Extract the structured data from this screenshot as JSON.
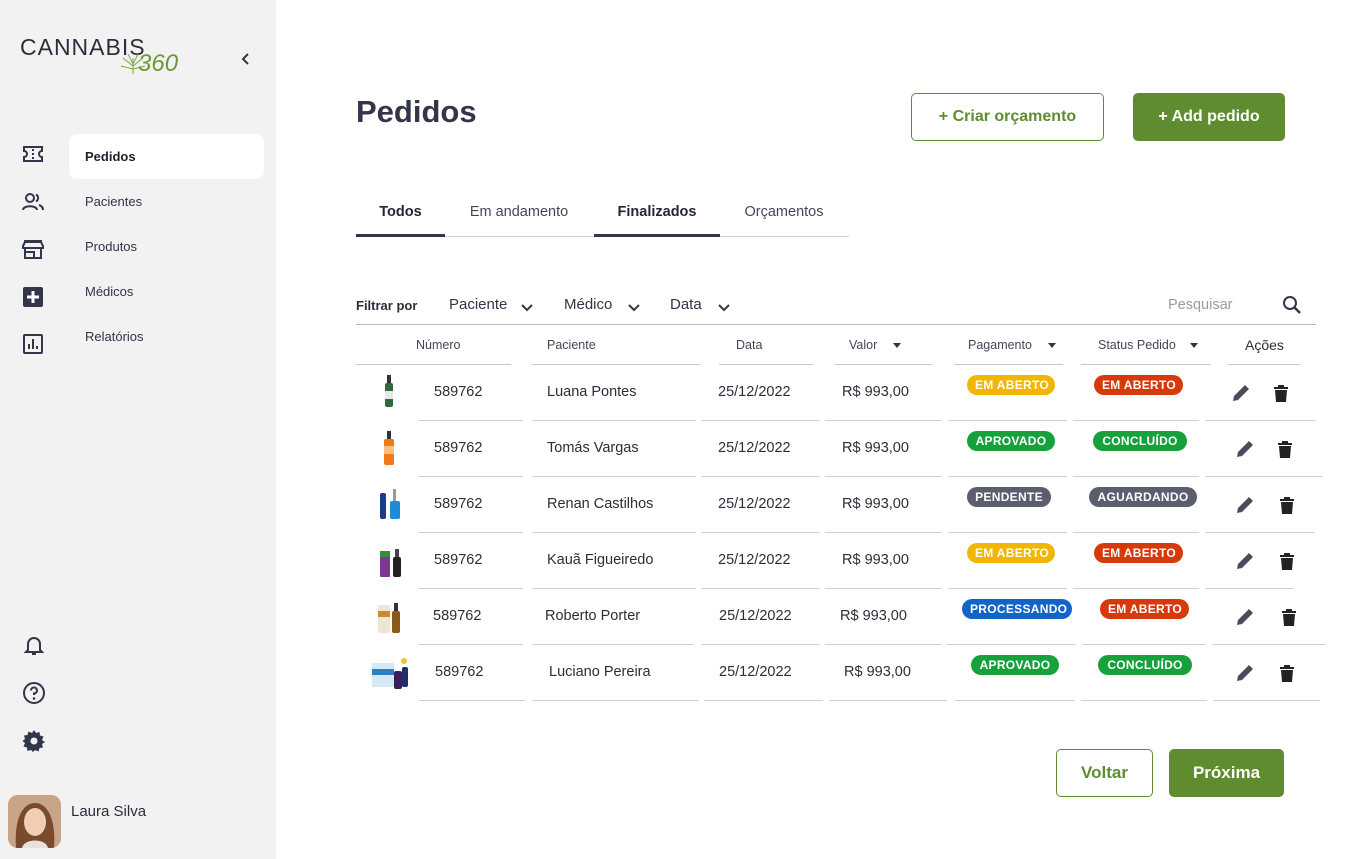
{
  "brand": {
    "word1": "CANNABIS",
    "word2": "360",
    "accent": "#5e8c2e"
  },
  "sidebar": {
    "items": [
      {
        "label": "Pedidos",
        "icon": "ticket-icon",
        "active": true
      },
      {
        "label": "Pacientes",
        "icon": "users-icon",
        "active": false
      },
      {
        "label": "Produtos",
        "icon": "store-icon",
        "active": false
      },
      {
        "label": "Médicos",
        "icon": "medical-plus-icon",
        "active": false
      },
      {
        "label": "Relatórios",
        "icon": "report-chart-icon",
        "active": false
      }
    ],
    "bottom_icons": [
      "bell-icon",
      "help-icon",
      "gear-icon"
    ],
    "user": {
      "name": "Laura Silva"
    }
  },
  "header": {
    "title": "Pedidos",
    "create_quote": "+ Criar orçamento",
    "add_order": "+ Add pedido"
  },
  "tabs": [
    {
      "label": "Todos",
      "active": true
    },
    {
      "label": "Em andamento",
      "active": false
    },
    {
      "label": "Finalizados",
      "active": true
    },
    {
      "label": "Orçamentos",
      "active": false
    }
  ],
  "filters": {
    "label": "Filtrar por",
    "options": [
      "Paciente",
      "Médico",
      "Data"
    ],
    "search_placeholder": "Pesquisar"
  },
  "table": {
    "columns": [
      "Número",
      "Paciente",
      "Data",
      "Valor",
      "Pagamento",
      "Status Pedido",
      "Ações"
    ],
    "rows": [
      {
        "numero": "589762",
        "paciente": "Luana Pontes",
        "data": "25/12/2022",
        "valor": "R$ 993,00",
        "pagamento": "EM ABERTO",
        "pagamento_color": "yellow",
        "status": "EM ABERTO",
        "status_color": "red"
      },
      {
        "numero": "589762",
        "paciente": "Tomás Vargas",
        "data": "25/12/2022",
        "valor": "R$ 993,00",
        "pagamento": "APROVADO",
        "pagamento_color": "green",
        "status": "CONCLUÍDO",
        "status_color": "green"
      },
      {
        "numero": "589762",
        "paciente": "Renan Castilhos",
        "data": "25/12/2022",
        "valor": "R$ 993,00",
        "pagamento": "PENDENTE",
        "pagamento_color": "gray",
        "status": "AGUARDANDO",
        "status_color": "gray"
      },
      {
        "numero": "589762",
        "paciente": "Kauã Figueiredo",
        "data": "25/12/2022",
        "valor": "R$ 993,00",
        "pagamento": "EM ABERTO",
        "pagamento_color": "yellow",
        "status": "EM ABERTO",
        "status_color": "red"
      },
      {
        "numero": "589762",
        "paciente": "Roberto Porter",
        "data": "25/12/2022",
        "valor": "R$ 993,00",
        "pagamento": "PROCESSANDO",
        "pagamento_color": "blue",
        "status": "EM ABERTO",
        "status_color": "red"
      },
      {
        "numero": "589762",
        "paciente": "Luciano Pereira",
        "data": "25/12/2022",
        "valor": "R$ 993,00",
        "pagamento": "APROVADO",
        "pagamento_color": "green",
        "status": "CONCLUÍDO",
        "status_color": "green"
      }
    ]
  },
  "pagination": {
    "back": "Voltar",
    "next": "Próxima"
  }
}
